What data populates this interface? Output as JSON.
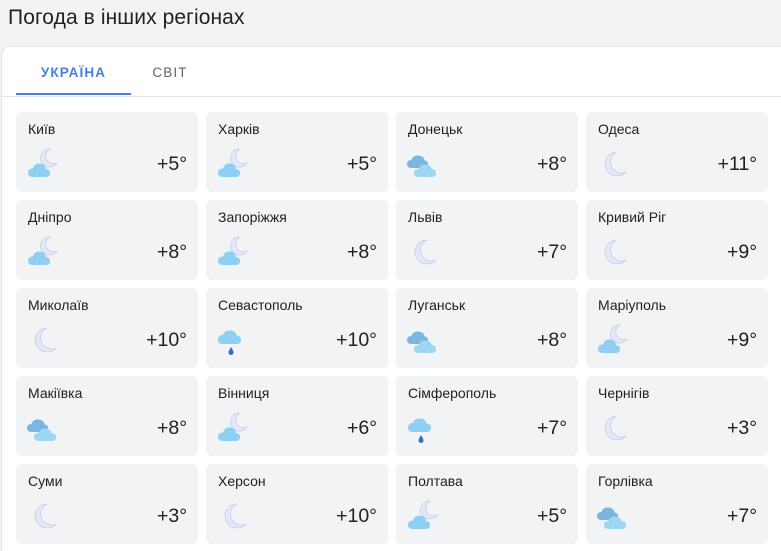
{
  "page": {
    "title": "Погода в інших регіонах"
  },
  "tabs": [
    {
      "label": "УКРАЇНА",
      "active": true
    },
    {
      "label": "СВІТ",
      "active": false
    }
  ],
  "colors": {
    "accent": "#4a7fd9",
    "card_bg": "#f1f3f4"
  },
  "cities": [
    {
      "name": "Київ",
      "temp": "+5°",
      "icon": "cloud-moon-icon"
    },
    {
      "name": "Харків",
      "temp": "+5°",
      "icon": "cloud-moon-icon"
    },
    {
      "name": "Донецьк",
      "temp": "+8°",
      "icon": "clouds-icon"
    },
    {
      "name": "Одеса",
      "temp": "+11°",
      "icon": "moon-icon"
    },
    {
      "name": "Дніпро",
      "temp": "+8°",
      "icon": "cloud-moon-icon"
    },
    {
      "name": "Запоріжжя",
      "temp": "+8°",
      "icon": "cloud-moon-icon"
    },
    {
      "name": "Львів",
      "temp": "+7°",
      "icon": "moon-icon"
    },
    {
      "name": "Кривий Ріг",
      "temp": "+9°",
      "icon": "moon-icon"
    },
    {
      "name": "Миколаїв",
      "temp": "+10°",
      "icon": "moon-icon"
    },
    {
      "name": "Севастополь",
      "temp": "+10°",
      "icon": "rain-cloud-icon"
    },
    {
      "name": "Луганськ",
      "temp": "+8°",
      "icon": "clouds-icon"
    },
    {
      "name": "Маріуполь",
      "temp": "+9°",
      "icon": "cloud-moon-icon"
    },
    {
      "name": "Макіївка",
      "temp": "+8°",
      "icon": "clouds-icon"
    },
    {
      "name": "Вінниця",
      "temp": "+6°",
      "icon": "cloud-moon-icon"
    },
    {
      "name": "Сімферополь",
      "temp": "+7°",
      "icon": "rain-cloud-icon"
    },
    {
      "name": "Чернігів",
      "temp": "+3°",
      "icon": "moon-icon"
    },
    {
      "name": "Суми",
      "temp": "+3°",
      "icon": "moon-icon"
    },
    {
      "name": "Херсон",
      "temp": "+10°",
      "icon": "moon-icon"
    },
    {
      "name": "Полтава",
      "temp": "+5°",
      "icon": "cloud-moon-icon"
    },
    {
      "name": "Горлівка",
      "temp": "+7°",
      "icon": "clouds-icon"
    }
  ]
}
